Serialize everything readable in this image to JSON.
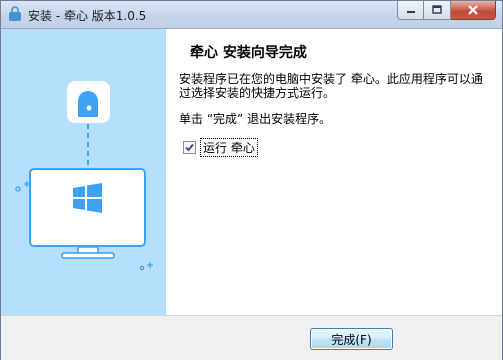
{
  "window": {
    "title": "安装 - 牵心 版本1.0.5"
  },
  "page": {
    "heading": "牵心 安装向导完成",
    "description": "安装程序已在您的电脑中安装了 牵心。此应用程序可以通过选择安装的快捷方式运行。",
    "instruction": "单击 “完成” 退出安装程序。"
  },
  "options": {
    "run_label": "运行 牵心",
    "run_checked": true
  },
  "buttons": {
    "finish_label": "完成(F)"
  },
  "colors": {
    "side_panel": "#b6defd",
    "accent": "#3ea2f0"
  },
  "icons": [
    "app-icon",
    "minimize-icon",
    "maximize-icon",
    "close-icon",
    "lock-icon",
    "arrow-down-icon",
    "windows-logo-icon",
    "monitor-icon",
    "sparkle-icon",
    "check-icon"
  ]
}
